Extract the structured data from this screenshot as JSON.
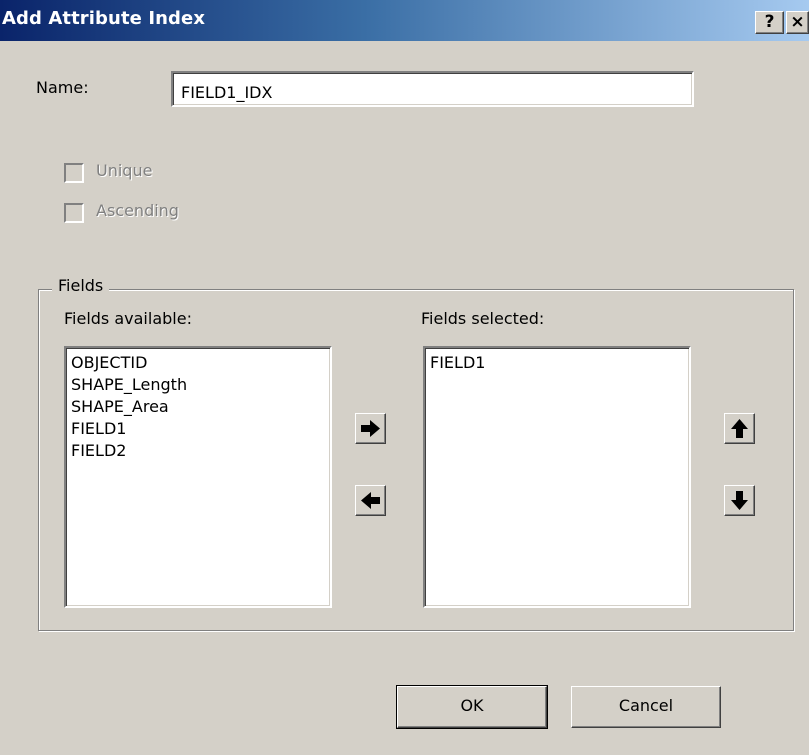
{
  "dialog": {
    "title": "Add Attribute Index",
    "help_button": "?",
    "close_button": "×"
  },
  "name": {
    "label": "Name:",
    "value": "FIELD1_IDX"
  },
  "options": {
    "unique_label": "Unique",
    "unique_checked": false,
    "unique_enabled": false,
    "ascending_label": "Ascending",
    "ascending_checked": false,
    "ascending_enabled": false
  },
  "fields": {
    "group_label": "Fields",
    "available_label": "Fields available:",
    "selected_label": "Fields selected:",
    "available": [
      "OBJECTID",
      "SHAPE_Length",
      "SHAPE_Area",
      "FIELD1",
      "FIELD2"
    ],
    "selected": [
      "FIELD1"
    ]
  },
  "icons": {
    "add": "arrow-right-icon",
    "remove": "arrow-left-icon",
    "move_up": "arrow-up-icon",
    "move_down": "arrow-down-icon"
  },
  "buttons": {
    "ok_label": "OK",
    "cancel_label": "Cancel"
  },
  "colors": {
    "title_start": "#0a246a",
    "title_end": "#a6caf0",
    "face": "#d4d0c8",
    "disabled_text": "#808080"
  }
}
